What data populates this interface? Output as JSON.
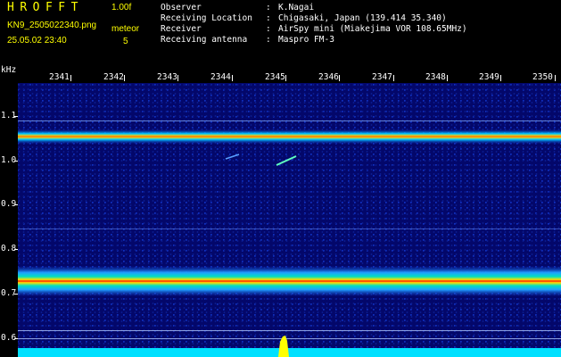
{
  "header": {
    "logo": "HROFFT",
    "version": "1.00f",
    "filename": "KN9_2505022340.png",
    "timestamp": "25.05.02 23:40",
    "meteor_label": "meteor",
    "meteor_count": "5",
    "info": [
      {
        "label": "Observer",
        "sep": ":",
        "value": "K.Nagai"
      },
      {
        "label": "Receiving Location",
        "sep": ":",
        "value": "Chigasaki, Japan (139.414 35.340)"
      },
      {
        "label": "Receiver",
        "sep": ":",
        "value": "AirSpy mini (Miakejima VOR 108.65MHz)"
      },
      {
        "label": "Receiving antenna",
        "sep": ":",
        "value": "Maspro FM-3"
      }
    ]
  },
  "spectrogram": {
    "y_unit": "kHz",
    "x_ticks": [
      "2341",
      "2342",
      "2343",
      "2344",
      "2345",
      "2346",
      "2347",
      "2348",
      "2349",
      "2350"
    ],
    "y_ticks": [
      "1.1",
      "1.0",
      "0.9",
      "0.8",
      "0.7",
      "0.6"
    ],
    "colors": {
      "background": "#03076a",
      "noise": "#1030c0",
      "band_core": "#ff3000",
      "band_mid": "#ffd000",
      "band_edge": "#00d0ff",
      "baseline": "#00e0ff",
      "burst": "#ffff00"
    }
  }
}
